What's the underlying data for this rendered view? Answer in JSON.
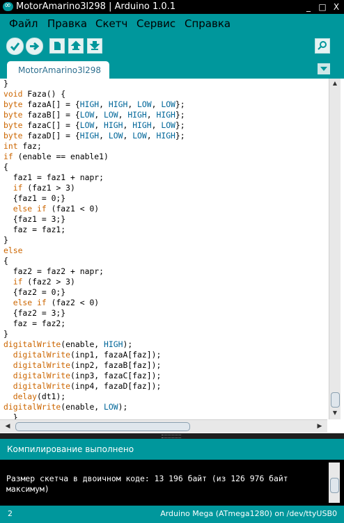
{
  "window": {
    "title": "MotorAmarino3l298 | Arduino 1.0.1",
    "controls": [
      "_",
      "□",
      "X"
    ]
  },
  "menu": [
    "Файл",
    "Правка",
    "Скетч",
    "Сервис",
    "Справка"
  ],
  "toolbar": {
    "buttons": [
      "verify-icon",
      "upload-icon",
      "new-icon",
      "open-icon",
      "save-icon"
    ],
    "serial_monitor": "magnifier-icon"
  },
  "tabs": [
    {
      "label": "MotorAmarino3l298"
    }
  ],
  "editor": {
    "lines": [
      "}",
      "void Faza() {",
      "byte fazaA[] = {HIGH, HIGH, LOW, LOW};",
      "byte fazaB[] = {LOW, LOW, HIGH, HIGH};",
      "byte fazaC[] = {LOW, HIGH, HIGH, LOW};",
      "byte fazaD[] = {HIGH, LOW, LOW, HIGH};",
      "int faz;",
      "if (enable == enable1)",
      "{",
      "  faz1 = faz1 + napr;",
      "  if (faz1 > 3)",
      "  {faz1 = 0;}",
      "  else if (faz1 < 0)",
      "  {faz1 = 3;}",
      "  faz = faz1;",
      "}",
      "else",
      "{",
      "  faz2 = faz2 + napr;",
      "  if (faz2 > 3)",
      "  {faz2 = 0;}",
      "  else if (faz2 < 0)",
      "  {faz2 = 3;}",
      "  faz = faz2;",
      "}",
      "digitalWrite(enable, HIGH);",
      "  digitalWrite(inp1, fazaA[faz]);",
      "  digitalWrite(inp2, fazaB[faz]);",
      "  digitalWrite(inp3, fazaC[faz]);",
      "  digitalWrite(inp4, fazaD[faz]);",
      "  delay(dt1);",
      "digitalWrite(enable, LOW);",
      "  }"
    ]
  },
  "status": {
    "message": "Компилирование выполнено"
  },
  "console": {
    "text": "Размер скетча в двоичном коде: 13 196 байт (из 126 976 байт максимум)"
  },
  "footer": {
    "line": "2",
    "board": "Arduino Mega (ATmega1280) on /dev/ttyUSB0"
  },
  "colors": {
    "teal": "#00979c",
    "keyword": "#cc6600",
    "constant": "#006699"
  }
}
